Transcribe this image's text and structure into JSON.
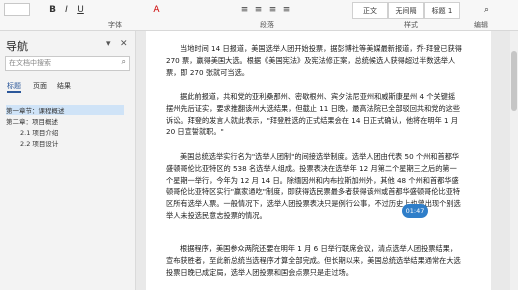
{
  "ribbon": {
    "groups": {
      "font": "字体",
      "paragraph": "段落",
      "styles": "样式",
      "editing": "编辑"
    },
    "font_buttons": [
      "B",
      "I",
      "U",
      "A"
    ],
    "styles": [
      {
        "label": "正文"
      },
      {
        "label": "无间隔"
      },
      {
        "label": "标题 1"
      }
    ],
    "editing_label": "编辑"
  },
  "nav": {
    "title": "导航",
    "search_placeholder": "在文档中搜索",
    "tabs": [
      {
        "label": "标题"
      },
      {
        "label": "页面"
      },
      {
        "label": "结果"
      }
    ],
    "items": [
      {
        "label": "第一章节：课程概述",
        "level": 1,
        "selected": true
      },
      {
        "label": "第二章：项目概述",
        "level": 1,
        "selected": false
      },
      {
        "label": "2.1 项目介绍",
        "level": 2,
        "selected": false
      },
      {
        "label": "2.2 项目设计",
        "level": 2,
        "selected": false
      }
    ]
  },
  "document": {
    "paragraphs": [
      {
        "text": "当地时间 14 日报道，美国选举人团开始投票，据彭博社等美媒最新报道，乔·拜登已获得 270 票，赢得美国大选。根据《美国宪法》及宪法修正案，总统候选人获得超过半数选举人票，即 270 张就可当选。"
      },
      {
        "text": "据此前报道，共和党的亚利桑那州、密歇根州、宾夕法尼亚州和威斯康星州 4 个关键摇摆州先后证实，要求推翻该州大选结果，但截止 11 日晚，最高法院已全部驳回共和党的这些诉讼。拜登的发言人就此表示，\"拜登胜选的正式结果会在 14 日正式确认，他将在明年 1 月 20 日宣誓就职。\""
      },
      {
        "text": "美国总统选举实行名为\"选举人团制\"的间接选举制度。选举人团由代表 50 个州和首都华盛顿哥伦比亚特区的 538 名选举人组成。投票表决在选举年 12 月第二个星期三之后的第一个星期一举行，今年为 12 月 14 日。除缅因州和内布拉斯加州外，其他 48 个州和首都华盛顿哥伦比亚特区实行\"赢家通吃\"制度，即获得选民票最多者获得该州或首都华盛顿哥伦比亚特区所有选举人票。一般情况下，选举人团投票表决只是例行公事，不过历史上也曾出现个别选举人未投选民意志投票的情况。"
      },
      {
        "text": "根据程序，美国参众两院还要在明年 1 月 6 日举行联席会议，清点选举人团投票结果，宣布获胜者，至此新总统当选程序才算全部完成。但长期以来，美国总统选举结果通常在大选投票日晚已成定局，选举人团投票和国会点票只是走过场。"
      }
    ],
    "time_badge": "01:47"
  }
}
